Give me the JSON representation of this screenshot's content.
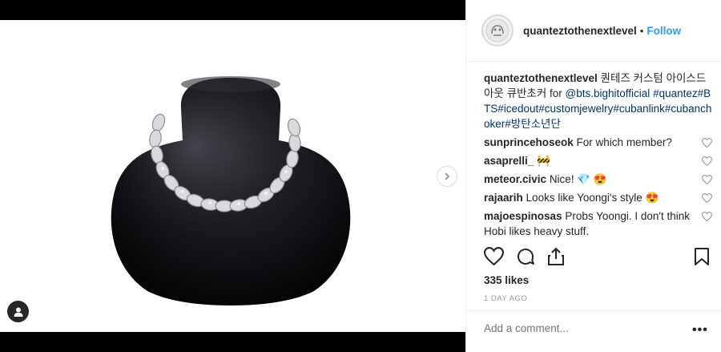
{
  "post": {
    "username": "quanteztothenextlevel",
    "follow_label": "Follow",
    "separator": "•"
  },
  "caption": {
    "username": "quanteztothenextlevel",
    "text_1": "퀀테즈 커스텀 아이스드 아웃 큐반초커 for",
    "mention": "@bts.bighitofficial",
    "hashtags": "#quantez#BTS#icedout#customjewelry#cubanlink#cubanchoker#방탄소년단"
  },
  "comments": [
    {
      "user": "sunprincehoseok",
      "text": "For which member?",
      "emoji": ""
    },
    {
      "user": "asaprelli_",
      "text": "",
      "emoji": "🚧"
    },
    {
      "user": "meteor.civic",
      "text": "Nice!",
      "emoji": "💎 😍"
    },
    {
      "user": "rajaarih",
      "text": "Looks like Yoongi's style",
      "emoji": "😍"
    },
    {
      "user": "majoespinosas",
      "text": "Probs Yoongi. I don't think Hobi likes heavy stuff.",
      "emoji": ""
    }
  ],
  "likes_text": "335 likes",
  "time_text": "1 DAY AGO",
  "add_comment_placeholder": "Add a comment...",
  "more_label": "•••",
  "icons": {
    "like": "heart-icon",
    "comment": "comment-icon",
    "share": "share-icon",
    "save": "bookmark-icon",
    "next": "chevron-right-icon",
    "tag": "user-tag-icon"
  }
}
